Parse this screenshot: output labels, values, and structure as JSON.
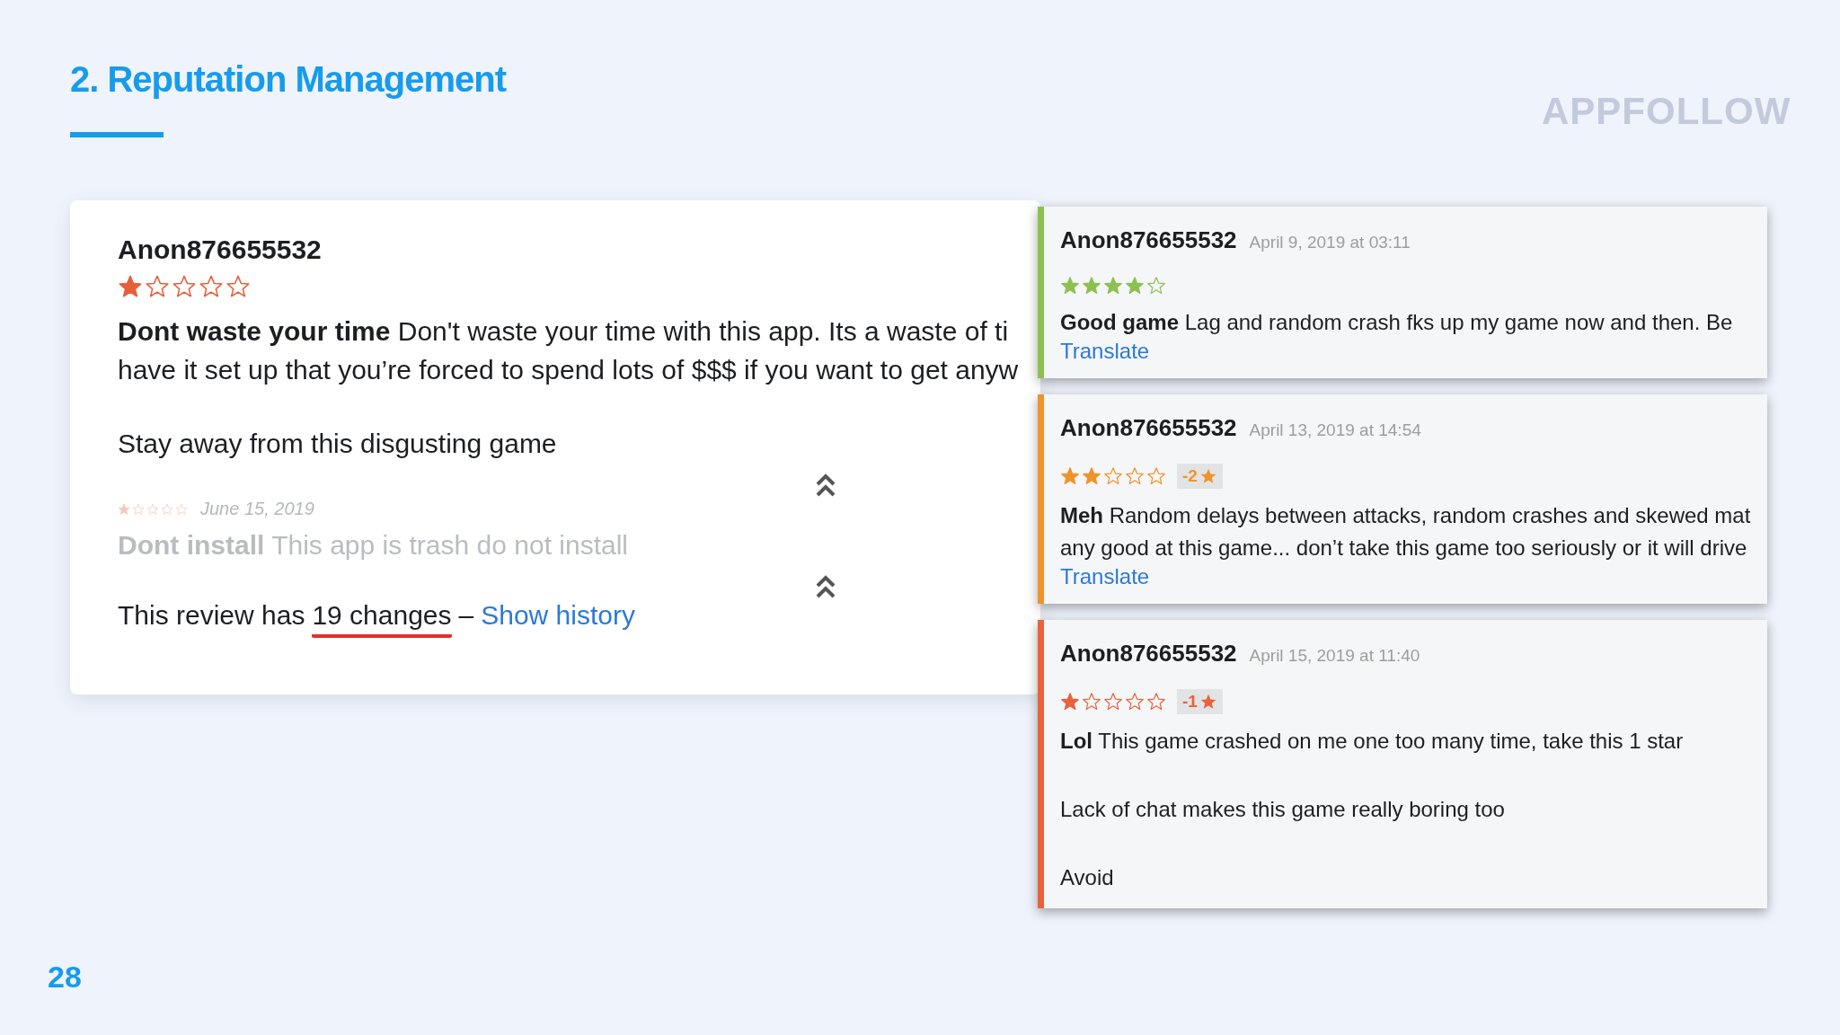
{
  "slide": {
    "title": "2. Reputation Management",
    "logo": "APPFOLLOW",
    "page_number": "28"
  },
  "review": {
    "author": "Anon876655532",
    "stars": 1,
    "lines": [
      "**Dont waste your time** Don't waste your time with this app. Its a waste of ti",
      "have it set up that you’re forced to spend lots of $$$ if you want to get anyw"
    ],
    "paragraph": "Stay away from this disgusting game",
    "previous": {
      "stars": 1,
      "date": "June 15, 2019",
      "text": "**Dont install** This app is trash do not install"
    },
    "changes_prefix": "This review has",
    "changes_count": "19 changes",
    "separator": "–",
    "history_link": "Show history"
  },
  "history": [
    {
      "author": "Anon876655532",
      "date": "April 9, 2019 at 03:11",
      "stars": 4,
      "color": "#8cc152",
      "paragraphs": [
        "**Good game** Lag and random crash fks up my game now and then. Be"
      ],
      "translate": "Translate"
    },
    {
      "author": "Anon876655532",
      "date": "April 13, 2019 at 14:54",
      "stars": 2,
      "color": "#f0932b",
      "change": "-2",
      "paragraphs": [
        "**Meh** Random delays between attacks,  random crashes and skewed mat",
        "any good at this game... don’t take this game too seriously or it will drive"
      ],
      "translate": "Translate"
    },
    {
      "author": "Anon876655532",
      "date": "April 15, 2019 at 11:40",
      "stars": 1,
      "color": "#e8623c",
      "change": "-1",
      "paragraphs": [
        "**Lol** This game crashed on me one too many time, take this 1 star",
        "Lack of chat makes this game really boring too",
        "Avoid"
      ]
    }
  ]
}
